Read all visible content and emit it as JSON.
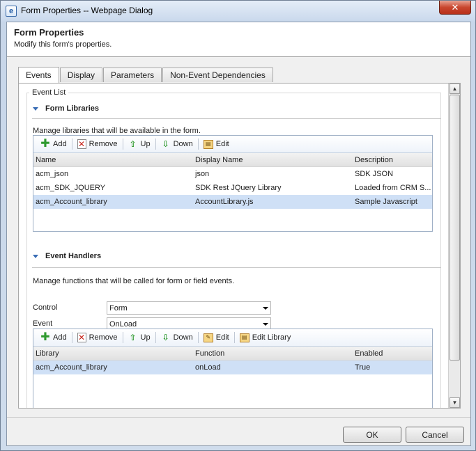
{
  "window": {
    "title": "Form Properties -- Webpage Dialog",
    "close_symbol": "✕"
  },
  "header": {
    "title": "Form Properties",
    "subtitle": "Modify this form's properties."
  },
  "tabs": [
    {
      "label": "Events",
      "active": true
    },
    {
      "label": "Display",
      "active": false
    },
    {
      "label": "Parameters",
      "active": false
    },
    {
      "label": "Non-Event Dependencies",
      "active": false
    }
  ],
  "event_list_label": "Event List",
  "form_libraries": {
    "heading": "Form Libraries",
    "description": "Manage libraries that will be available in the form.",
    "toolbar": [
      {
        "label": "Add",
        "icon": "add-icon"
      },
      {
        "label": "Remove",
        "icon": "remove-icon"
      },
      {
        "label": "Up",
        "icon": "arrow-up-icon"
      },
      {
        "label": "Down",
        "icon": "arrow-down-icon"
      },
      {
        "label": "Edit",
        "icon": "edit-icon"
      }
    ],
    "columns": [
      "Name",
      "Display Name",
      "Description"
    ],
    "rows": [
      {
        "name": "acm_json",
        "display": "json",
        "description": "SDK JSON",
        "selected": false
      },
      {
        "name": "acm_SDK_JQUERY",
        "display": "SDK Rest JQuery Library",
        "description": "Loaded from CRM S...",
        "selected": false
      },
      {
        "name": "acm_Account_library",
        "display": "AccountLibrary.js",
        "description": "Sample Javascript",
        "selected": true
      }
    ]
  },
  "event_handlers": {
    "heading": "Event Handlers",
    "description": "Manage functions that will be called for form or field events.",
    "control_label": "Control",
    "control_value": "Form",
    "event_label": "Event",
    "event_value": "OnLoad",
    "toolbar": [
      {
        "label": "Add",
        "icon": "add-icon"
      },
      {
        "label": "Remove",
        "icon": "remove-icon"
      },
      {
        "label": "Up",
        "icon": "arrow-up-icon"
      },
      {
        "label": "Down",
        "icon": "arrow-down-icon"
      },
      {
        "label": "Edit",
        "icon": "edit-icon"
      },
      {
        "label": "Edit Library",
        "icon": "edit-library-icon"
      }
    ],
    "columns": [
      "Library",
      "Function",
      "Enabled"
    ],
    "rows": [
      {
        "library": "acm_Account_library",
        "function": "onLoad",
        "enabled": "True",
        "selected": true
      }
    ]
  },
  "buttons": {
    "ok": "OK",
    "cancel": "Cancel"
  }
}
